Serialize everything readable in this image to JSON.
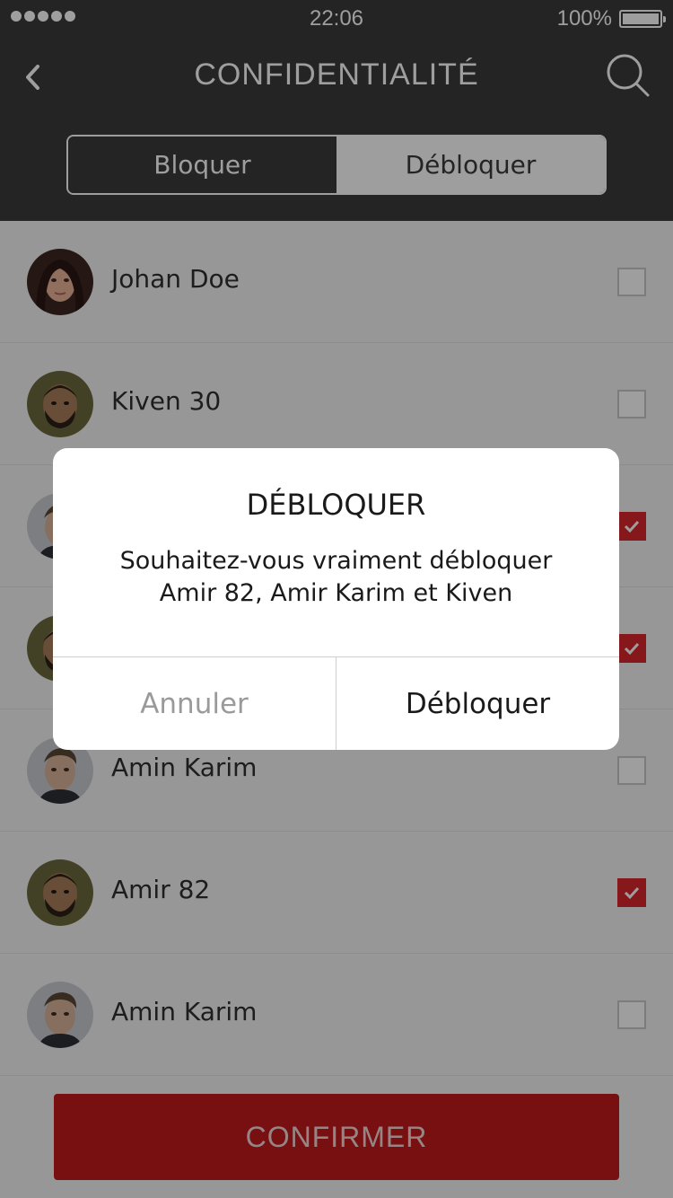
{
  "status_bar": {
    "time": "22:06",
    "battery": "100%"
  },
  "header": {
    "title": "CONFIDENTIALITÉ"
  },
  "segment": {
    "block": "Bloquer",
    "unblock": "Débloquer",
    "active": "unblock"
  },
  "contacts": [
    {
      "name": "Johan Doe",
      "checked": false,
      "avatar": "woman-dark-hair"
    },
    {
      "name": "Kiven 30",
      "checked": false,
      "avatar": "man-beard"
    },
    {
      "name": "",
      "checked": true,
      "avatar": "man-short-hair"
    },
    {
      "name": "",
      "checked": true,
      "avatar": "man-beard"
    },
    {
      "name": "Amin Karim",
      "checked": false,
      "avatar": "man-short-hair"
    },
    {
      "name": "Amir 82",
      "checked": true,
      "avatar": "man-beard"
    },
    {
      "name": "Amin Karim",
      "checked": false,
      "avatar": "man-short-hair"
    }
  ],
  "footer": {
    "confirm_label": "CONFIRMER"
  },
  "dialog": {
    "title": "DÉBLOQUER",
    "message_line1": "Souhaitez-vous vraiment débloquer",
    "message_line2": "Amir 82, Amir Karim et Kiven",
    "cancel_label": "Annuler",
    "confirm_label": "Débloquer"
  },
  "colors": {
    "header_bg": "#3a3a3a",
    "accent": "#c2191c",
    "checkbox_on": "#d8262b"
  }
}
